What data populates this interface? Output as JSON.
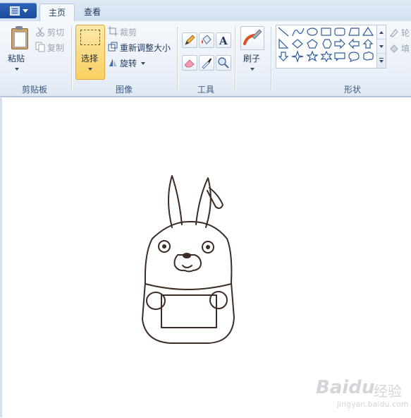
{
  "tabs": [
    {
      "label": "主页"
    },
    {
      "label": "查看"
    }
  ],
  "file_button": {
    "icon": "file-menu-icon"
  },
  "groups": {
    "clipboard": {
      "label": "剪贴板",
      "paste": "粘贴",
      "cut": "剪切",
      "copy": "复制"
    },
    "image": {
      "label": "图像",
      "select": "选择",
      "crop": "裁剪",
      "resize": "重新调整大小",
      "rotate": "旋转"
    },
    "tools": {
      "label": "工具",
      "items": [
        "pencil-icon",
        "fill-bucket-icon",
        "text-icon",
        "eraser-icon",
        "color-picker-icon",
        "magnifier-icon"
      ]
    },
    "brushes": {
      "label": "刷子"
    },
    "shapes": {
      "label": "形状",
      "outline": "轮",
      "fill": "填"
    }
  },
  "watermark": {
    "brand": "Baidu",
    "suffix": "经验",
    "url": "jingyan.baidu.com"
  },
  "colors": {
    "ribbon_bg": "#f5f8fc",
    "active_select": "#f9cf61",
    "text": "#1e395b"
  }
}
